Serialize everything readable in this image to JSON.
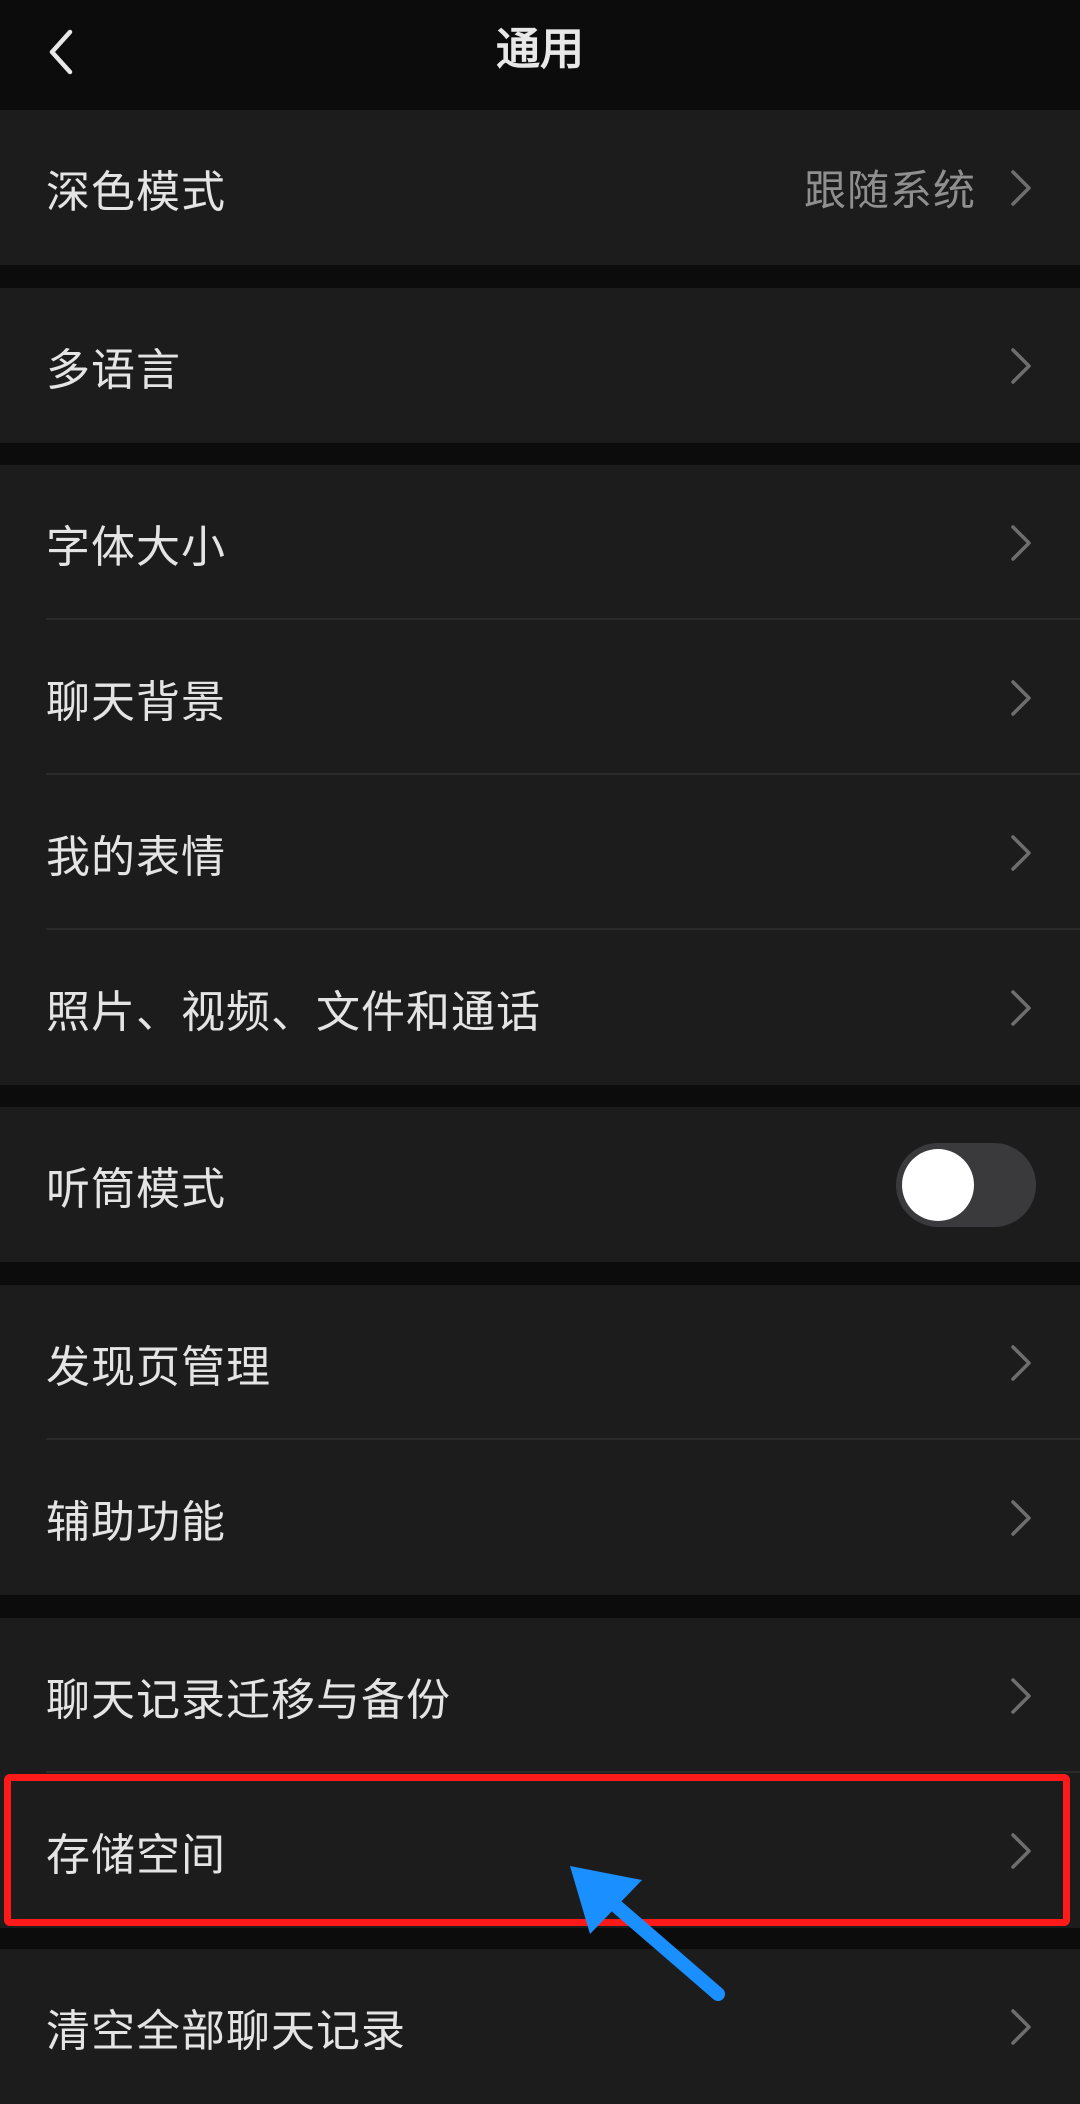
{
  "header": {
    "title": "通用",
    "back_icon": "chevron-left-icon"
  },
  "dark_mode": {
    "label": "深色模式",
    "value": "跟随系统"
  },
  "language": {
    "label": "多语言"
  },
  "display": {
    "font_size": "字体大小",
    "chat_background": "聊天背景",
    "my_stickers": "我的表情",
    "media_files_calls": "照片、视频、文件和通话"
  },
  "earpiece_mode": {
    "label": "听筒模式",
    "enabled": false
  },
  "features": {
    "discover_management": "发现页管理",
    "accessibility": "辅助功能"
  },
  "storage": {
    "chat_migration_backup": "聊天记录迁移与备份",
    "storage_space": "存储空间",
    "clear_all_chats": "清空全部聊天记录"
  },
  "colors": {
    "background": "#0c0c0c",
    "cell": "#1c1c1c",
    "text": "#e4e4e4",
    "secondary_text": "#8f8f8f",
    "highlight_box": "#ff1a1a",
    "annotation_arrow": "#1a8fff"
  }
}
